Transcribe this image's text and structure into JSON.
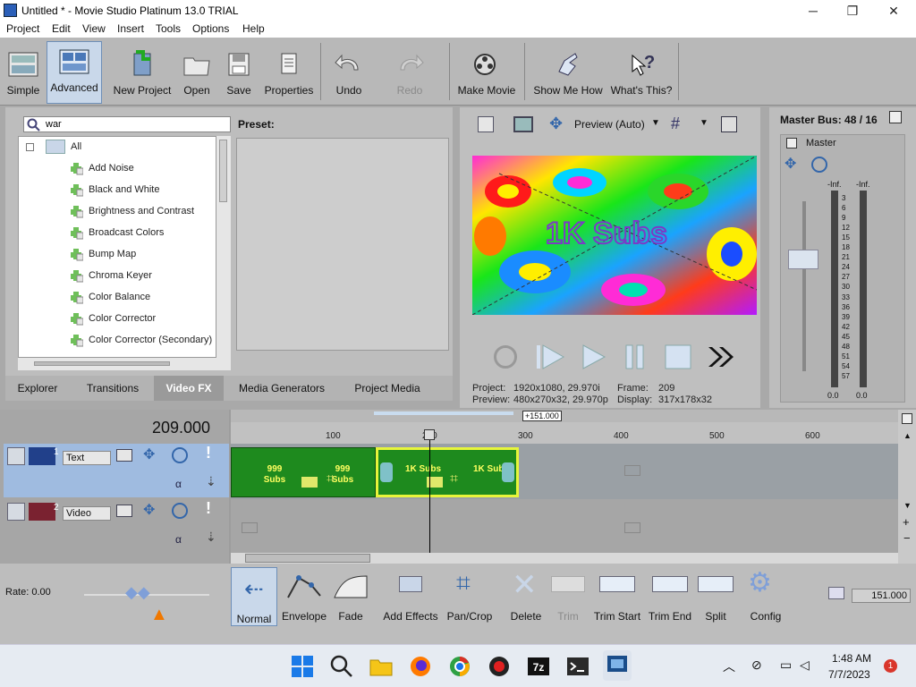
{
  "window": {
    "title": "Untitled * - Movie Studio Platinum 13.0 TRIAL",
    "min": "─",
    "max": "❐",
    "close": "✕"
  },
  "menu": [
    "Project",
    "Edit",
    "View",
    "Insert",
    "Tools",
    "Options",
    "Help"
  ],
  "toolbar": {
    "simple": "Simple",
    "advanced": "Advanced",
    "new_project": "New Project",
    "open": "Open",
    "save": "Save",
    "properties": "Properties",
    "undo": "Undo",
    "redo": "Redo",
    "make_movie": "Make Movie",
    "show_me_how": "Show Me How",
    "whats_this": "What's This?"
  },
  "fx_panel": {
    "search_value": "war",
    "preset_label": "Preset:",
    "tree_root": "All",
    "items": [
      "Add Noise",
      "Black and White",
      "Brightness and Contrast",
      "Broadcast Colors",
      "Bump Map",
      "Chroma Keyer",
      "Color Balance",
      "Color Corrector",
      "Color Corrector (Secondary)"
    ]
  },
  "tabs": [
    "Explorer",
    "Transitions",
    "Video FX",
    "Media Generators",
    "Project Media"
  ],
  "preview": {
    "mode": "Preview (Auto)",
    "overlay_text": "1K Subs",
    "project_label": "Project:",
    "project_value": "1920x1080, 29.970i",
    "preview_label": "Preview:",
    "preview_value": "480x270x32, 29.970p",
    "frame_label": "Frame:",
    "frame_value": "209",
    "display_label": "Display:",
    "display_value": "317x178x32"
  },
  "mixer": {
    "title": "Master Bus: 48 / 16",
    "channel": "Master",
    "peak_left": "-Inf.",
    "peak_right": "-Inf.",
    "scale": [
      "3",
      "6",
      "9",
      "12",
      "15",
      "18",
      "21",
      "24",
      "27",
      "30",
      "33",
      "36",
      "39",
      "42",
      "45",
      "48",
      "51",
      "54",
      "57"
    ],
    "bottom_left": "0.0",
    "bottom_right": "0.0"
  },
  "timeline": {
    "timecode": "209.000",
    "loop_region": "+151.000",
    "ruler": [
      "100",
      "200",
      "300",
      "400",
      "500",
      "600"
    ],
    "track1_num": "1",
    "track1_name": "Text",
    "track2_num": "2",
    "track2_name": "Video",
    "clip1_a": "999 Subs",
    "clip1_b": "999 Subs",
    "clip2_a": "1K Subs",
    "clip2_b": "1K Subs"
  },
  "edit_toolbar": {
    "rate": "Rate: 0.00",
    "normal": "Normal",
    "envelope": "Envelope",
    "fade": "Fade",
    "add_effects": "Add Effects",
    "pan_crop": "Pan/Crop",
    "delete": "Delete",
    "trim": "Trim",
    "trim_start": "Trim Start",
    "trim_end": "Trim End",
    "split": "Split",
    "config": "Config",
    "time_value": "151.000"
  },
  "taskbar": {
    "time": "1:48 AM",
    "date": "7/7/2023",
    "notif_count": "1",
    "chevron": "︿"
  },
  "colors": {
    "accent": "#2b5fb8",
    "clip_green": "#1e8a1e",
    "selected_clip_border": "#e7f53a"
  }
}
